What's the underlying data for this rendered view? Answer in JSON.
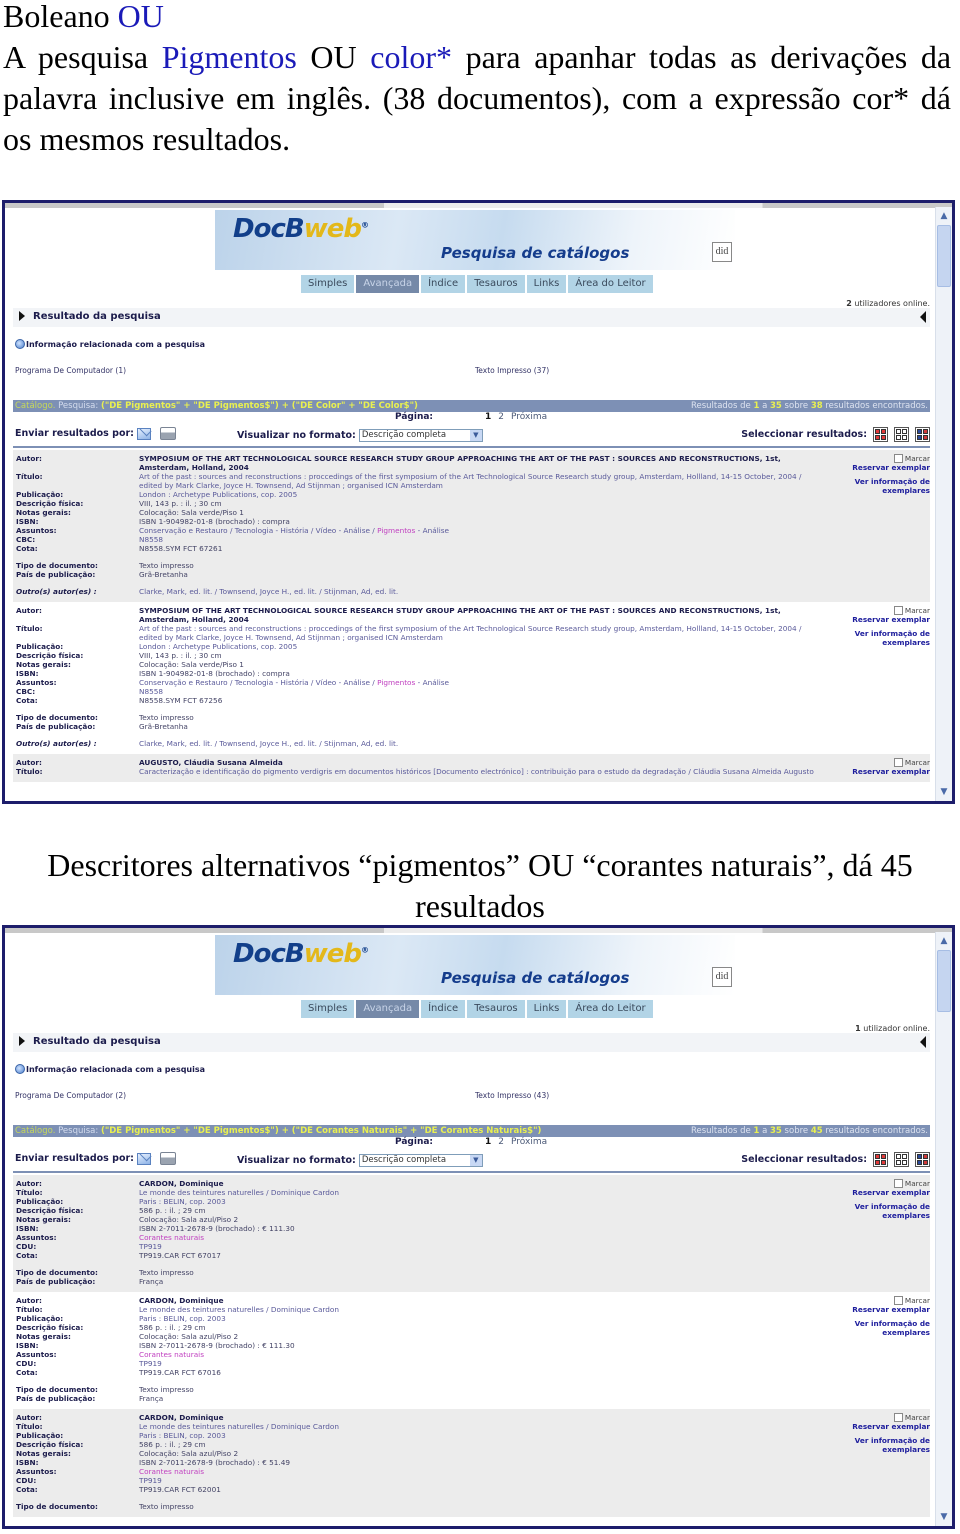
{
  "intro": {
    "heading_prefix": "Boleano ",
    "heading_highlight": "OU",
    "para_parts": [
      "A pesquisa ",
      "Pigmentos",
      " OU ",
      "color*",
      " para apanhar todas as derivações da palavra inclusive em inglês. (38 documentos), com a expressão cor* dá os mesmos resultados."
    ]
  },
  "caption": "Descritores alternativos “pigmentos” OU “corantes naturais”, dá 45 resultados",
  "screens": [
    {
      "logo_main": "DocB",
      "logo_accent": "web",
      "logo_reg": "®",
      "banner_title": "Pesquisa de catálogos",
      "did_logo": "did",
      "nav": [
        "Simples",
        "Avançada",
        "Índice",
        "Tesauros",
        "Links",
        "Área do Leitor"
      ],
      "nav_active": 1,
      "users_count": "2",
      "users_text": " utilizadores online.",
      "result_label": "Resultado da pesquisa",
      "info_label": "Informação relacionada com a pesquisa",
      "facet_left": "Programa De Computador (1)",
      "facet_right": "Texto Impresso (37)",
      "query_label": "Catálogo.",
      "query_prefix": " Pesquisa: ",
      "query_expr": "(\"DE Pigmentos\" + \"DE Pigmentos$\") + (\"DE Color\" + \"DE Color$\")",
      "results_pre": "Resultados de ",
      "results_from": "1",
      "results_mid1": " a ",
      "results_to": "35",
      "results_mid2": " sobre ",
      "results_total": "38",
      "results_post": " resultados encontrados.",
      "page_label": "Página:",
      "pages": [
        "1",
        "2"
      ],
      "next_label": "Próxima",
      "send_label": "Enviar resultados por:",
      "format_label": "Visualizar no formato:",
      "format_value": "Descrição completa",
      "select_label": "Seleccionar resultados:",
      "mark_label": "Marcar",
      "reserve_label": "Reservar exemplar",
      "copies_label": "Ver informação de exemplares",
      "records": [
        {
          "fields": [
            {
              "label": "Autor:",
              "value": "SYMPOSIUM OF THE ART TECHNOLOGICAL SOURCE RESEARCH STUDY GROUP APPROACHING THE ART OF THE PAST : SOURCES AND RECONSTRUCTIONS, 1st, Amsterdam, Holland, 2004",
              "style": "author"
            },
            {
              "label": "Título:",
              "value": "Art of the past : sources and reconstructions : proccedings of the first symposium of the Art Technological Source Research study group, Amsterdam, Hollland, 14-15 October, 2004 / edited by Mark Clarke, Joyce H. Townsend, Ad Stijnman ; organised ICN Amsterdam",
              "style": "link"
            },
            {
              "label": "Publicação:",
              "value": "London : Archetype Publications, cop. 2005",
              "style": "link"
            },
            {
              "label": "Descrição física:",
              "value": "VIII, 143 p. : il. ; 30 cm",
              "style": ""
            },
            {
              "label": "Notas gerais:",
              "value": "Colocação: Sala verde/Piso 1",
              "style": ""
            },
            {
              "label": "ISBN:",
              "value": "ISBN 1-904982-01-8 (brochado) : compra",
              "style": ""
            },
            {
              "label": "Assuntos:",
              "value": "Conservação e Restauro / Tecnologia - História / Vídeo - Análise / ",
              "pink": "Pigmentos",
              "after": " - Análise",
              "style": "link"
            },
            {
              "label": "CBC:",
              "value": "N8558",
              "style": "link"
            },
            {
              "label": "Cota:",
              "value": "N8558.SYM FCT 67261",
              "style": ""
            }
          ],
          "extra": [
            {
              "label": "Tipo de documento:",
              "value": "Texto impresso"
            },
            {
              "label": "País de publicação:",
              "value": "Grã-Bretanha"
            }
          ],
          "other": {
            "label": "Outro(s) autor(es) :",
            "value": "Clarke, Mark, ed. lit. / Townsend, Joyce H., ed. lit. / Stijnman, Ad, ed. lit."
          }
        },
        {
          "fields": [
            {
              "label": "Autor:",
              "value": "SYMPOSIUM OF THE ART TECHNOLOGICAL SOURCE RESEARCH STUDY GROUP APPROACHING THE ART OF THE PAST : SOURCES AND RECONSTRUCTIONS, 1st, Amsterdam, Holland, 2004",
              "style": "author"
            },
            {
              "label": "Título:",
              "value": "Art of the past : sources and reconstructions : proccedings of the first symposium of the Art Technological Source Research study group, Amsterdam, Hollland, 14-15 October, 2004 / edited by Mark Clarke, Joyce H. Townsend, Ad Stijnman ; organised ICN Amsterdam",
              "style": "link"
            },
            {
              "label": "Publicação:",
              "value": "London : Archetype Publications, cop. 2005",
              "style": "link"
            },
            {
              "label": "Descrição física:",
              "value": "VIII, 143 p. : il. ; 30 cm",
              "style": ""
            },
            {
              "label": "Notas gerais:",
              "value": "Colocação: Sala verde/Piso 1",
              "style": ""
            },
            {
              "label": "ISBN:",
              "value": "ISBN 1-904982-01-8 (brochado) : compra",
              "style": ""
            },
            {
              "label": "Assuntos:",
              "value": "Conservação e Restauro / Tecnologia - História / Vídeo - Análise / ",
              "pink": "Pigmentos",
              "after": " - Análise",
              "style": "link"
            },
            {
              "label": "CBC:",
              "value": "N8558",
              "style": "link"
            },
            {
              "label": "Cota:",
              "value": "N8558.SYM FCT 67256",
              "style": ""
            }
          ],
          "extra": [
            {
              "label": "Tipo de documento:",
              "value": "Texto impresso"
            },
            {
              "label": "País de publicação:",
              "value": "Grã-Bretanha"
            }
          ],
          "other": {
            "label": "Outro(s) autor(es) :",
            "value": "Clarke, Mark, ed. lit. / Townsend, Joyce H., ed. lit. / Stijnman, Ad, ed. lit."
          }
        },
        {
          "fields": [
            {
              "label": "Autor:",
              "value": "AUGUSTO, Cláudia Susana Almeida",
              "style": "author"
            },
            {
              "label": "Título:",
              "value": "Caracterização e identificação do pigmento verdigris em documentos históricos [Documento electrónico] : contribuição para o estudo da degradação / Cláudia Susana Almeida Augusto",
              "style": "link"
            }
          ],
          "extra": [],
          "other": null,
          "no_copies": true
        }
      ]
    },
    {
      "logo_main": "DocB",
      "logo_accent": "web",
      "logo_reg": "®",
      "banner_title": "Pesquisa de catálogos",
      "did_logo": "did",
      "nav": [
        "Simples",
        "Avançada",
        "Índice",
        "Tesauros",
        "Links",
        "Área do Leitor"
      ],
      "nav_active": 1,
      "users_count": "1",
      "users_text": " utilizador online.",
      "result_label": "Resultado da pesquisa",
      "info_label": "Informação relacionada com a pesquisa",
      "facet_left": "Programa De Computador (2)",
      "facet_right": "Texto Impresso (43)",
      "query_label": "Catálogo.",
      "query_prefix": " Pesquisa: ",
      "query_expr": "(\"DE Pigmentos\" + \"DE Pigmentos$\") + (\"DE Corantes Naturais\" + \"DE Corantes Naturais$\")",
      "results_pre": "Resultados de ",
      "results_from": "1",
      "results_mid1": " a ",
      "results_to": "35",
      "results_mid2": " sobre ",
      "results_total": "45",
      "results_post": " resultados encontrados.",
      "page_label": "Página:",
      "pages": [
        "1",
        "2"
      ],
      "next_label": "Próxima",
      "send_label": "Enviar resultados por:",
      "format_label": "Visualizar no formato:",
      "format_value": "Descrição completa",
      "select_label": "Seleccionar resultados:",
      "mark_label": "Marcar",
      "reserve_label": "Reservar exemplar",
      "copies_label": "Ver informação de exemplares",
      "records": [
        {
          "fields": [
            {
              "label": "Autor:",
              "value": "CARDON, Dominique",
              "style": "author"
            },
            {
              "label": "Título:",
              "value": "Le monde des teintures naturelles / Dominique Cardon",
              "style": "link"
            },
            {
              "label": "Publicação:",
              "value": "Paris : BELIN, cop. 2003",
              "style": "link"
            },
            {
              "label": "Descrição física:",
              "value": "586 p. : il. ; 29 cm",
              "style": ""
            },
            {
              "label": "Notas gerais:",
              "value": "Colocação: Sala azul/Piso 2",
              "style": ""
            },
            {
              "label": "ISBN:",
              "value": "ISBN 2-7011-2678-9 (brochado) : € 111.30",
              "style": ""
            },
            {
              "label": "Assuntos:",
              "value": "",
              "pink": "Corantes naturais",
              "after": "",
              "style": "link"
            },
            {
              "label": "CDU:",
              "value": "TP919",
              "style": "link"
            },
            {
              "label": "Cota:",
              "value": "TP919.CAR FCT 67017",
              "style": ""
            }
          ],
          "extra": [
            {
              "label": "Tipo de documento:",
              "value": "Texto impresso"
            },
            {
              "label": "País de publicação:",
              "value": "França"
            }
          ],
          "other": null
        },
        {
          "fields": [
            {
              "label": "Autor:",
              "value": "CARDON, Dominique",
              "style": "author"
            },
            {
              "label": "Título:",
              "value": "Le monde des teintures naturelles / Dominique Cardon",
              "style": "link"
            },
            {
              "label": "Publicação:",
              "value": "Paris : BELIN, cop. 2003",
              "style": "link"
            },
            {
              "label": "Descrição física:",
              "value": "586 p. : il. ; 29 cm",
              "style": ""
            },
            {
              "label": "Notas gerais:",
              "value": "Colocação: Sala azul/Piso 2",
              "style": ""
            },
            {
              "label": "ISBN:",
              "value": "ISBN 2-7011-2678-9 (brochado) : € 111.30",
              "style": ""
            },
            {
              "label": "Assuntos:",
              "value": "",
              "pink": "Corantes naturais",
              "after": "",
              "style": "link"
            },
            {
              "label": "CDU:",
              "value": "TP919",
              "style": "link"
            },
            {
              "label": "Cota:",
              "value": "TP919.CAR FCT 67016",
              "style": ""
            }
          ],
          "extra": [
            {
              "label": "Tipo de documento:",
              "value": "Texto impresso"
            },
            {
              "label": "País de publicação:",
              "value": "França"
            }
          ],
          "other": null
        },
        {
          "fields": [
            {
              "label": "Autor:",
              "value": "CARDON, Dominique",
              "style": "author"
            },
            {
              "label": "Título:",
              "value": "Le monde des teintures naturelles / Dominique Cardon",
              "style": "link"
            },
            {
              "label": "Publicação:",
              "value": "Paris : BELIN, cop. 2003",
              "style": "link"
            },
            {
              "label": "Descrição física:",
              "value": "586 p. : il. ; 29 cm",
              "style": ""
            },
            {
              "label": "Notas gerais:",
              "value": "Colocação: Sala azul/Piso 2",
              "style": ""
            },
            {
              "label": "ISBN:",
              "value": "ISBN 2-7011-2678-9 (brochado) : € 51.49",
              "style": ""
            },
            {
              "label": "Assuntos:",
              "value": "",
              "pink": "Corantes naturais",
              "after": "",
              "style": "link"
            },
            {
              "label": "CDU:",
              "value": "TP919",
              "style": "link"
            },
            {
              "label": "Cota:",
              "value": "TP919.CAR FCT 62001",
              "style": ""
            }
          ],
          "extra": [
            {
              "label": "Tipo de documento:",
              "value": "Texto impresso"
            }
          ],
          "other": null
        }
      ]
    }
  ]
}
